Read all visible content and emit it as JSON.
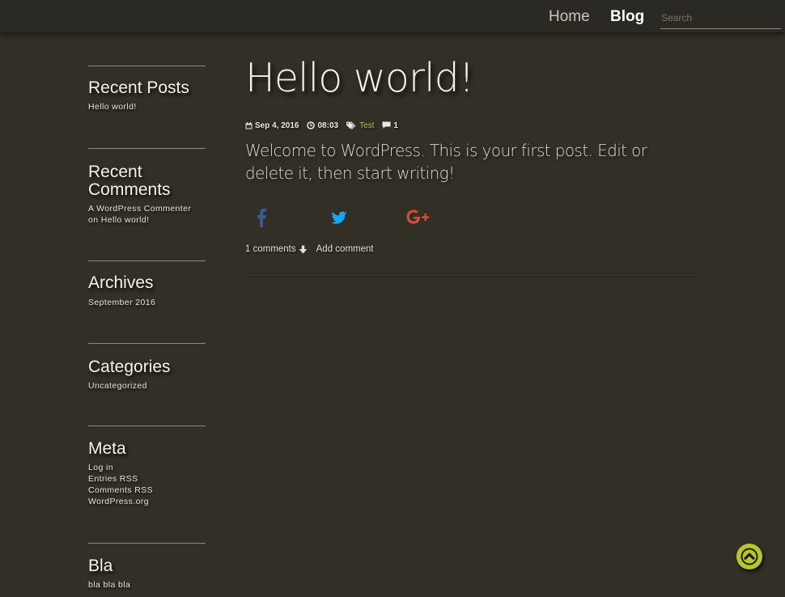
{
  "nav": {
    "home_label": "Home",
    "blog_label": "Blog",
    "search_placeholder": "Search"
  },
  "sidebar": {
    "widgets": [
      {
        "title": "Recent Posts",
        "items": [
          "Hello world!"
        ]
      },
      {
        "title": "Recent Comments",
        "items": [
          "A WordPress Commenter",
          "on Hello world!"
        ]
      },
      {
        "title": "Archives",
        "items": [
          "September 2016"
        ]
      },
      {
        "title": "Categories",
        "items": [
          "Uncategorized"
        ]
      },
      {
        "title": "Meta",
        "items": [
          "Log in",
          "Entries RSS",
          "Comments RSS",
          "WordPress.org"
        ]
      },
      {
        "title": "Bla",
        "items": [
          "bla bla bla"
        ]
      }
    ]
  },
  "post": {
    "title": "Hello world!",
    "date": "Sep 4, 2016",
    "time": "08:03",
    "tag": "Test",
    "comment_count": "1",
    "excerpt": "Welcome to WordPress. This is your first post. Edit or delete it, then start writing!",
    "comments_link": "1 comments",
    "add_comment": "Add comment"
  },
  "icons": {
    "facebook": "facebook-icon",
    "twitter": "twitter-icon",
    "google_plus": "google-plus-icon",
    "back_to_top": "chevron-up-icon"
  },
  "colors": {
    "background": "#322f26",
    "topbar": "#2b2923",
    "accent": "#b6c62b",
    "tag": "#c3c93a",
    "facebook": "#3b5998",
    "twitter": "#1da1f2",
    "google_plus": "#dd4b39"
  }
}
